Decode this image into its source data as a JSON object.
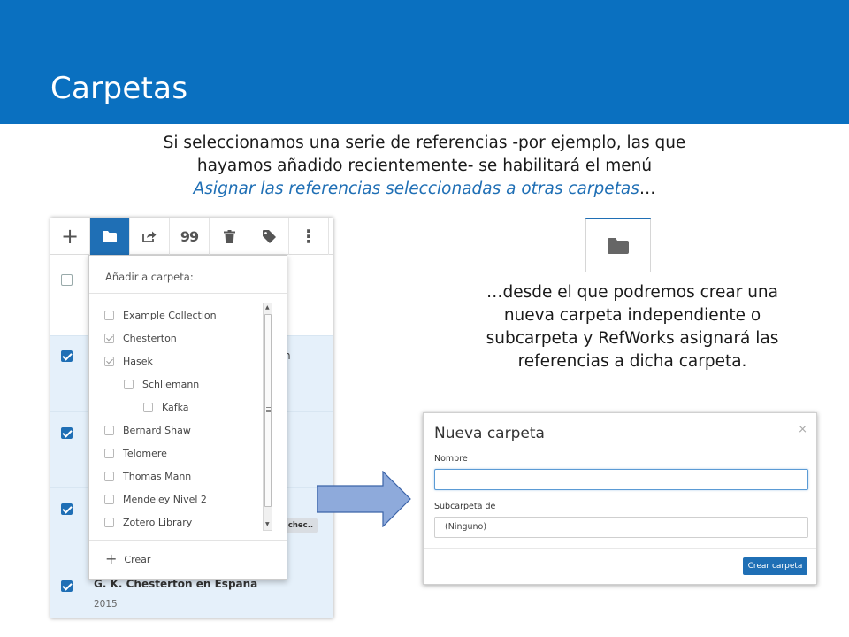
{
  "header": {
    "title": "Carpetas"
  },
  "intro": {
    "line1": "Si seleccionamos una serie de referencias -por ejemplo, las que",
    "line2": "hayamos añadido recientemente- se habilitará el menú",
    "line3_em": "Asignar las referencias seleccionadas a otras carpetas",
    "line3_tail": "…"
  },
  "toolbar": {
    "buttons": [
      {
        "name": "add-icon",
        "glyph": "+"
      },
      {
        "name": "folder-icon",
        "glyph": ""
      },
      {
        "name": "share-icon",
        "glyph": ""
      },
      {
        "name": "quote-icon",
        "glyph": "99"
      },
      {
        "name": "trash-icon",
        "glyph": ""
      },
      {
        "name": "tag-icon",
        "glyph": ""
      },
      {
        "name": "more-icon",
        "glyph": "⋮"
      }
    ]
  },
  "references": {
    "fragment_row1": "n",
    "chip": "chec..",
    "last_title": "G. K. Chesterton en España",
    "last_year": "2015"
  },
  "dropdown": {
    "title": "Añadir a carpeta:",
    "items": [
      {
        "label": "Example Collection",
        "checked": false,
        "level": 0
      },
      {
        "label": "Chesterton",
        "checked": true,
        "level": 0
      },
      {
        "label": "Hasek",
        "checked": true,
        "level": 0
      },
      {
        "label": "Schliemann",
        "checked": false,
        "level": 1
      },
      {
        "label": "Kafka",
        "checked": false,
        "level": 2
      },
      {
        "label": "Bernard Shaw",
        "checked": false,
        "level": 0
      },
      {
        "label": "Telomere",
        "checked": false,
        "level": 0
      },
      {
        "label": "Thomas Mann",
        "checked": false,
        "level": 0
      },
      {
        "label": "Mendeley Nivel 2",
        "checked": false,
        "level": 0
      },
      {
        "label": "Zotero Library",
        "checked": false,
        "level": 0
      }
    ],
    "create_label": "Crear"
  },
  "right_text": {
    "line1": "…desde el que podremos crear una",
    "line2": "nueva carpeta independiente o",
    "line3": "subcarpeta y RefWorks asignará las",
    "line4": "referencias a dicha carpeta."
  },
  "dialog": {
    "title": "Nueva carpeta",
    "close": "×",
    "name_label": "Nombre",
    "name_value": "",
    "parent_label": "Subcarpeta de",
    "parent_value": "(Ninguno)",
    "submit_label": "Crear carpeta"
  },
  "colors": {
    "header_bg": "#0a70c0",
    "accent": "#1f6fb5",
    "selected_row": "#e5f0fa",
    "arrow_fill": "#8eaadb"
  }
}
